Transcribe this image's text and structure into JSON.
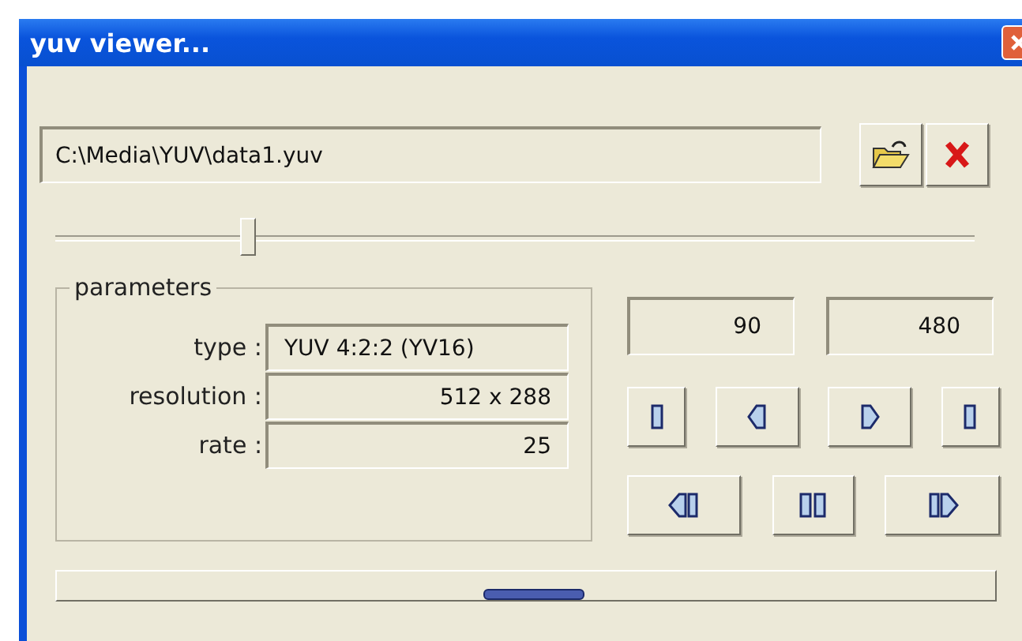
{
  "window": {
    "title": "yuv viewer..."
  },
  "file": {
    "path": "C:\\Media\\YUV\\data1.yuv"
  },
  "position_slider": {
    "level": 0.21
  },
  "parameters": {
    "title": "parameters",
    "rows": [
      {
        "label": "type :",
        "value": "YUV 4:2:2 (YV16)",
        "kind": "text"
      },
      {
        "label": "resolution :",
        "value": "512 x 288",
        "kind": "number"
      },
      {
        "label": "rate :",
        "value": "25",
        "kind": "number"
      }
    ]
  },
  "frame_fields": [
    "90",
    "480"
  ],
  "controls": [
    [
      {
        "kind": "first"
      },
      {
        "kind": "prev"
      },
      {
        "kind": "next"
      },
      {
        "kind": "last"
      }
    ],
    [
      {
        "kind": "rewind"
      },
      {
        "kind": "pause"
      },
      {
        "kind": "play"
      }
    ]
  ]
}
